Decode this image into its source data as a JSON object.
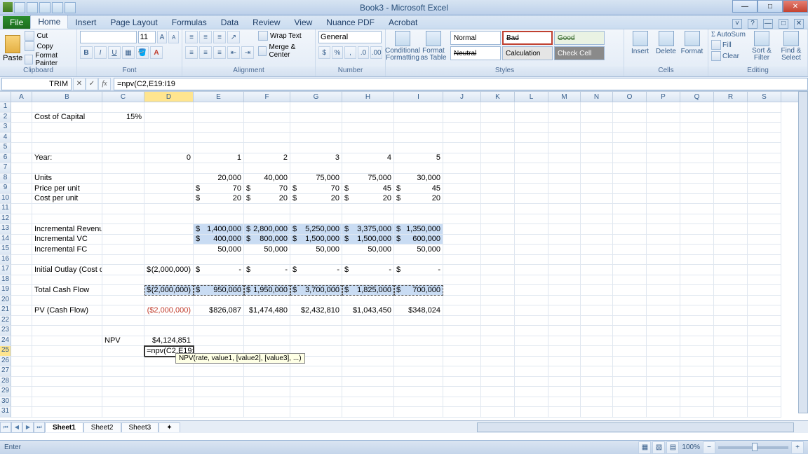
{
  "title": "Book3 - Microsoft Excel",
  "qat": [
    "save",
    "undo",
    "redo",
    "print",
    "open"
  ],
  "win_btns": {
    "min": "—",
    "max": "□",
    "close": "✕"
  },
  "tabs": {
    "file": "File",
    "items": [
      "Home",
      "Insert",
      "Page Layout",
      "Formulas",
      "Data",
      "Review",
      "View",
      "Nuance PDF",
      "Acrobat"
    ],
    "active": 0
  },
  "help_icons": {
    "mini": "˅",
    "help": "?",
    "min_ribbon": "^",
    "restore": "□",
    "close": "✕"
  },
  "clipboard": {
    "paste": "Paste",
    "cut": "Cut",
    "copy": "Copy",
    "fp": "Format Painter",
    "label": "Clipboard"
  },
  "font": {
    "name": "",
    "size": "11",
    "grow": "A",
    "shrink": "A",
    "bold": "B",
    "italic": "I",
    "underline": "U",
    "label": "Font"
  },
  "alignment": {
    "wrap": "Wrap Text",
    "merge": "Merge & Center",
    "label": "Alignment"
  },
  "number": {
    "format": "General",
    "label": "Number",
    "pct": "%",
    "comma": ",",
    "inc": ".0",
    "dec": ".00",
    "acc": "$"
  },
  "styles": {
    "cond": "Conditional\nFormatting",
    "table": "Format\nas Table",
    "normal": "Normal",
    "bad": "Bad",
    "good": "Good",
    "neutral": "Neutral",
    "calc": "Calculation",
    "check": "Check Cell",
    "label": "Styles"
  },
  "cells": {
    "insert": "Insert",
    "delete": "Delete",
    "format": "Format",
    "label": "Cells"
  },
  "editing": {
    "autosum": "AutoSum",
    "fill": "Fill",
    "clear": "Clear",
    "sort": "Sort &\nFilter",
    "find": "Find &\nSelect",
    "label": "Editing"
  },
  "fx": {
    "name_box": "TRIM",
    "cancel": "✕",
    "enter": "✓",
    "fx": "fx",
    "formula": "=npv(C2,E19:I19"
  },
  "cols": [
    {
      "l": "A",
      "w": 30
    },
    {
      "l": "B",
      "w": 100
    },
    {
      "l": "C",
      "w": 60
    },
    {
      "l": "D",
      "w": 70
    },
    {
      "l": "E",
      "w": 72
    },
    {
      "l": "F",
      "w": 66
    },
    {
      "l": "G",
      "w": 74
    },
    {
      "l": "H",
      "w": 74
    },
    {
      "l": "I",
      "w": 70
    },
    {
      "l": "J",
      "w": 54
    },
    {
      "l": "K",
      "w": 48
    },
    {
      "l": "L",
      "w": 48
    },
    {
      "l": "M",
      "w": 46
    },
    {
      "l": "N",
      "w": 46
    },
    {
      "l": "O",
      "w": 48
    },
    {
      "l": "P",
      "w": 48
    },
    {
      "l": "Q",
      "w": 48
    },
    {
      "l": "R",
      "w": 48
    },
    {
      "l": "S",
      "w": 48
    }
  ],
  "active_col": 3,
  "rows_visible": 31,
  "active_row_index": 24,
  "labels": {
    "coc": "Cost of Capital",
    "year": "Year:",
    "units": "Units",
    "ppu": "Price per unit",
    "cpu": "Cost per unit",
    "rev": "Incremental Revenue",
    "vc": "Incremental VC",
    "fc": "Incremental FC",
    "outlay": "Initial Outlay (Cost of Software)",
    "tcf": "Total Cash Flow",
    "pv": "PV (Cash Flow)",
    "npv": "NPV"
  },
  "vals": {
    "coc": "15%",
    "year": [
      "0",
      "1",
      "2",
      "3",
      "4",
      "5"
    ],
    "units": [
      "20,000",
      "40,000",
      "75,000",
      "75,000",
      "30,000"
    ],
    "ppu": [
      "70",
      "70",
      "70",
      "45",
      "45"
    ],
    "cpu": [
      "20",
      "20",
      "20",
      "20",
      "20"
    ],
    "rev": [
      "1,400,000",
      "2,800,000",
      "5,250,000",
      "3,375,000",
      "1,350,000"
    ],
    "vc": [
      "400,000",
      "800,000",
      "1,500,000",
      "1,500,000",
      "600,000"
    ],
    "fc": [
      "50,000",
      "50,000",
      "50,000",
      "50,000",
      "50,000"
    ],
    "outlay": [
      "(2,000,000)",
      "-",
      "-",
      "-",
      "-",
      "-"
    ],
    "tcf": [
      "(2,000,000)",
      "950,000",
      "1,950,000",
      "3,700,000",
      "1,825,000",
      "700,000"
    ],
    "pv": [
      "($2,000,000)",
      "$826,087",
      "$1,474,480",
      "$2,432,810",
      "$1,043,450",
      "$348,024"
    ],
    "npv": "$4,124,851",
    "editing": "=npv(C2,E19:I19"
  },
  "tooltip": "NPV(rate, value1, [value2], [value3], ...)",
  "sheets": {
    "items": [
      "Sheet1",
      "Sheet2",
      "Sheet3"
    ],
    "active": 0,
    "arrows": [
      "⏮",
      "◀",
      "▶",
      "⏭"
    ]
  },
  "status": {
    "mode": "Enter",
    "zoom": "100%",
    "minus": "−",
    "plus": "+"
  }
}
